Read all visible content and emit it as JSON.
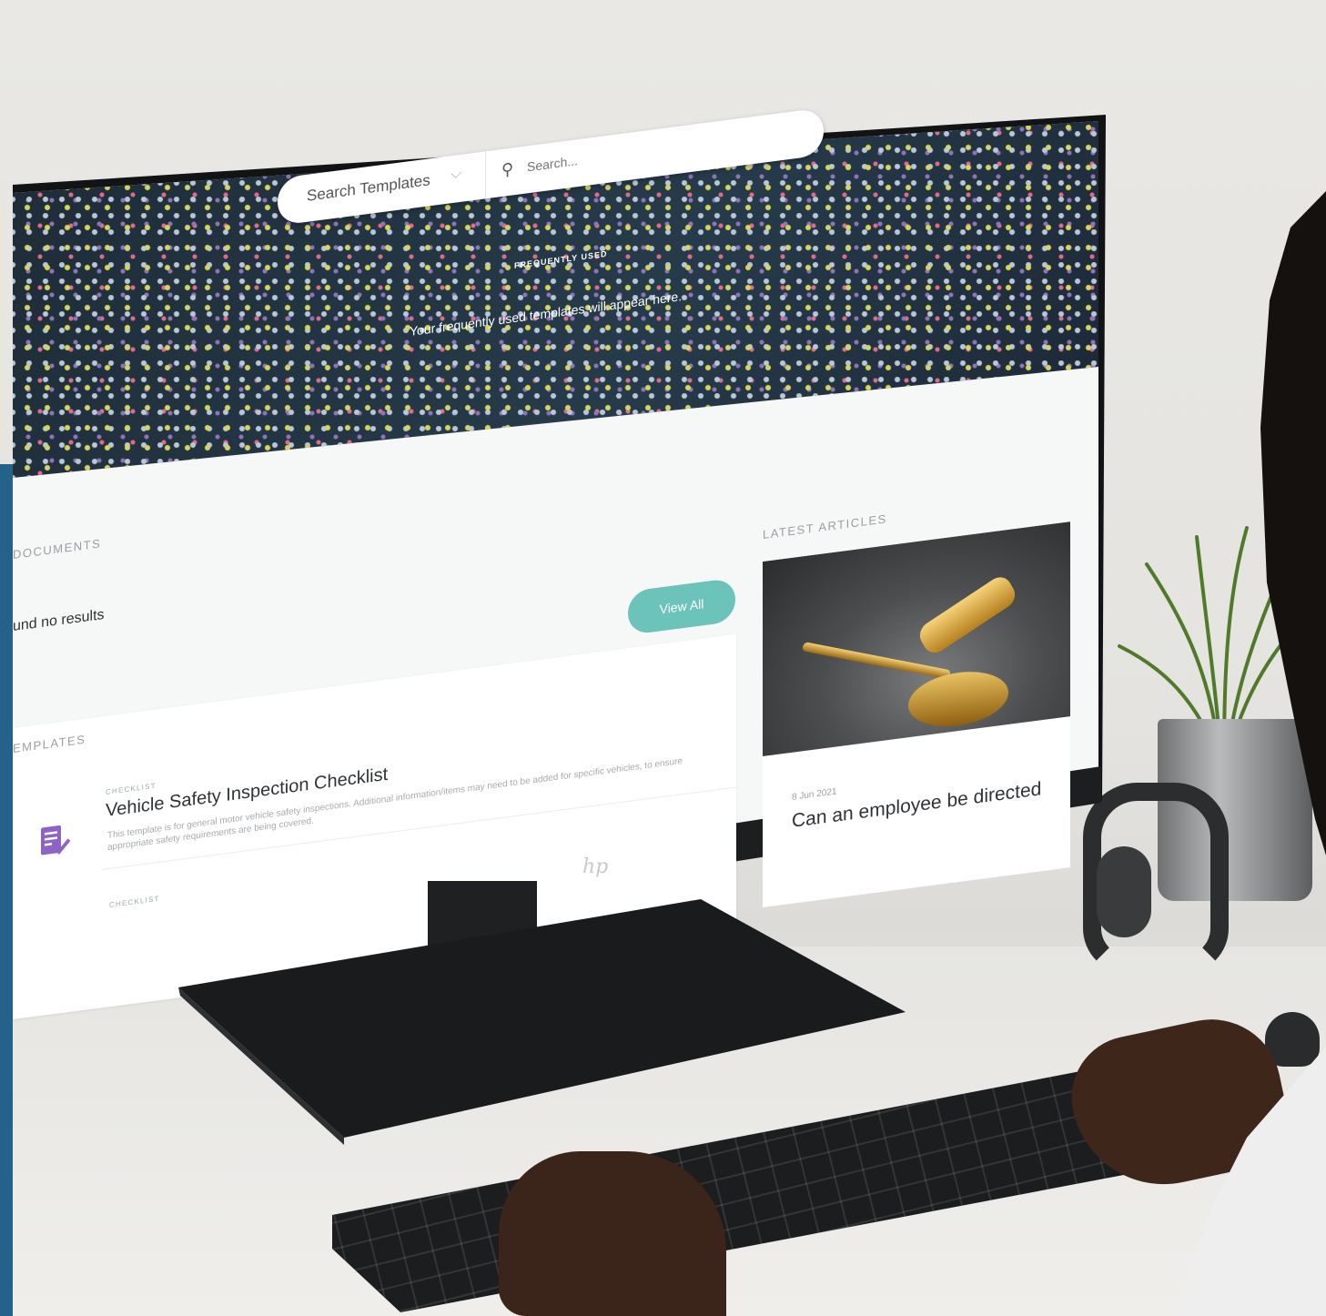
{
  "search": {
    "select_label": "Search Templates",
    "placeholder": "Search..."
  },
  "frequently_used": {
    "label": "FREQUENTLY USED",
    "empty_text": "Your frequently used templates will appear here."
  },
  "documents": {
    "section_label": "DOCUMENTS",
    "empty_text": "und no results",
    "view_all_label": "View All"
  },
  "templates": {
    "section_label": "EMPLATES",
    "items": [
      {
        "type": "CHECKLIST",
        "title": "Vehicle Safety Inspection Checklist",
        "description": "This template is for general motor vehicle safety inspections. Additional information/items may need to be added for specific vehicles, to ensure appropriate safety requirements are being covered."
      },
      {
        "type": "CHECKLIST"
      }
    ]
  },
  "articles": {
    "section_label": "LATEST ARTICLES",
    "items": [
      {
        "date": "8 Jun 2021",
        "title": "Can an employee be directed"
      }
    ]
  },
  "monitor": {
    "logo": "hp"
  },
  "colors": {
    "accent": "#6cc3ba",
    "left_strip": "#24628a",
    "template_icon": "#8e63c7"
  },
  "icons": {
    "search": "search-icon",
    "select_chevron": "chevron-down-icon",
    "template": "checklist-icon"
  }
}
